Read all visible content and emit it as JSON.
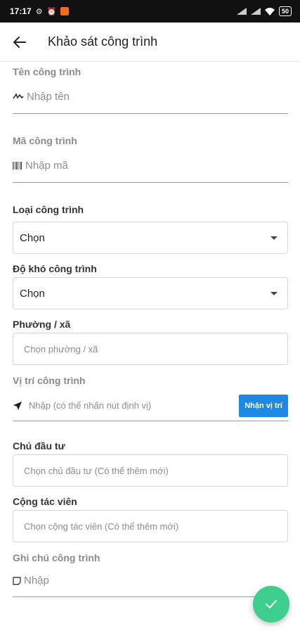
{
  "status_bar": {
    "time": "17:17",
    "battery": "50"
  },
  "app_bar": {
    "title": "Khảo sát công trình"
  },
  "form": {
    "ten_cong_trinh": {
      "label": "Tên công trình",
      "placeholder": "Nhập tên",
      "icon": "signature-icon"
    },
    "ma_cong_trinh": {
      "label": "Mã công trình",
      "placeholder": "Nhập mã",
      "icon": "barcode-icon"
    },
    "loai_cong_trinh": {
      "label": "Loại công trình",
      "value": "Chọn"
    },
    "do_kho": {
      "label": "Độ khó công trình",
      "value": "Chọn"
    },
    "phuong_xa": {
      "label": "Phường / xã",
      "placeholder": "Chọn phường / xã"
    },
    "vi_tri": {
      "label": "Vị trí công trình",
      "placeholder": "Nhập (có thể nhấn nút định vị)",
      "button": "Nhận vị trí",
      "icon": "navigation-icon"
    },
    "chu_dau_tu": {
      "label": "Chủ đầu tư",
      "placeholder": "Chọn chủ đầu tư (Có thể thêm mới)"
    },
    "cong_tac_vien": {
      "label": "Cộng tác viên",
      "placeholder": "Chọn cộng tác viên (Có thể thêm mới)"
    },
    "ghi_chu": {
      "label": "Ghi chú công trình",
      "placeholder": "Nhập",
      "icon": "note-icon"
    }
  },
  "colors": {
    "accent": "#1e88e5",
    "fab": "#3ecf8e"
  }
}
